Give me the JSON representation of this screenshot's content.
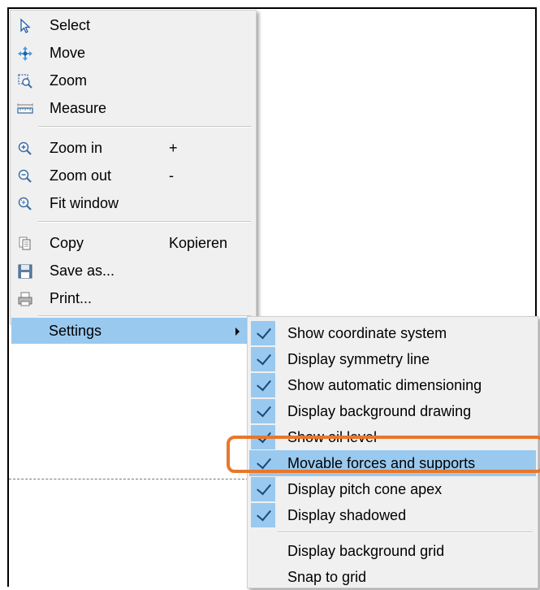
{
  "menu": {
    "items": [
      {
        "label": "Select",
        "icon": "cursor-arrow-icon"
      },
      {
        "label": "Move",
        "icon": "move-arrows-icon"
      },
      {
        "label": "Zoom",
        "icon": "zoom-rect-icon"
      },
      {
        "label": "Measure",
        "icon": "ruler-icon"
      },
      {
        "label": "Zoom in",
        "shortcut": "+",
        "icon": "zoom-in-icon"
      },
      {
        "label": "Zoom out",
        "shortcut": "-",
        "icon": "zoom-out-icon"
      },
      {
        "label": "Fit window",
        "icon": "fit-window-icon"
      },
      {
        "label": "Copy",
        "shortcut": "Kopieren",
        "icon": "copy-icon"
      },
      {
        "label": "Save as...",
        "icon": "save-icon"
      },
      {
        "label": "Print...",
        "icon": "print-icon"
      },
      {
        "label": "Settings",
        "submenu": true
      }
    ]
  },
  "submenu": {
    "items": [
      {
        "label": "Show coordinate system",
        "checked": true
      },
      {
        "label": "Display symmetry line",
        "checked": true
      },
      {
        "label": "Show automatic dimensioning",
        "checked": true
      },
      {
        "label": "Display background drawing",
        "checked": true
      },
      {
        "label": "Show oil level",
        "checked": true
      },
      {
        "label": "Movable forces and supports",
        "checked": true,
        "highlighted": true
      },
      {
        "label": "Display pitch cone apex",
        "checked": true
      },
      {
        "label": "Display shadowed",
        "checked": true
      },
      {
        "label": "Display background grid",
        "checked": false
      },
      {
        "label": "Snap to grid",
        "checked": false
      }
    ]
  },
  "colors": {
    "highlight": "#99c9ef",
    "annotation": "#e8772a",
    "menu_bg": "#f0f0f0"
  }
}
